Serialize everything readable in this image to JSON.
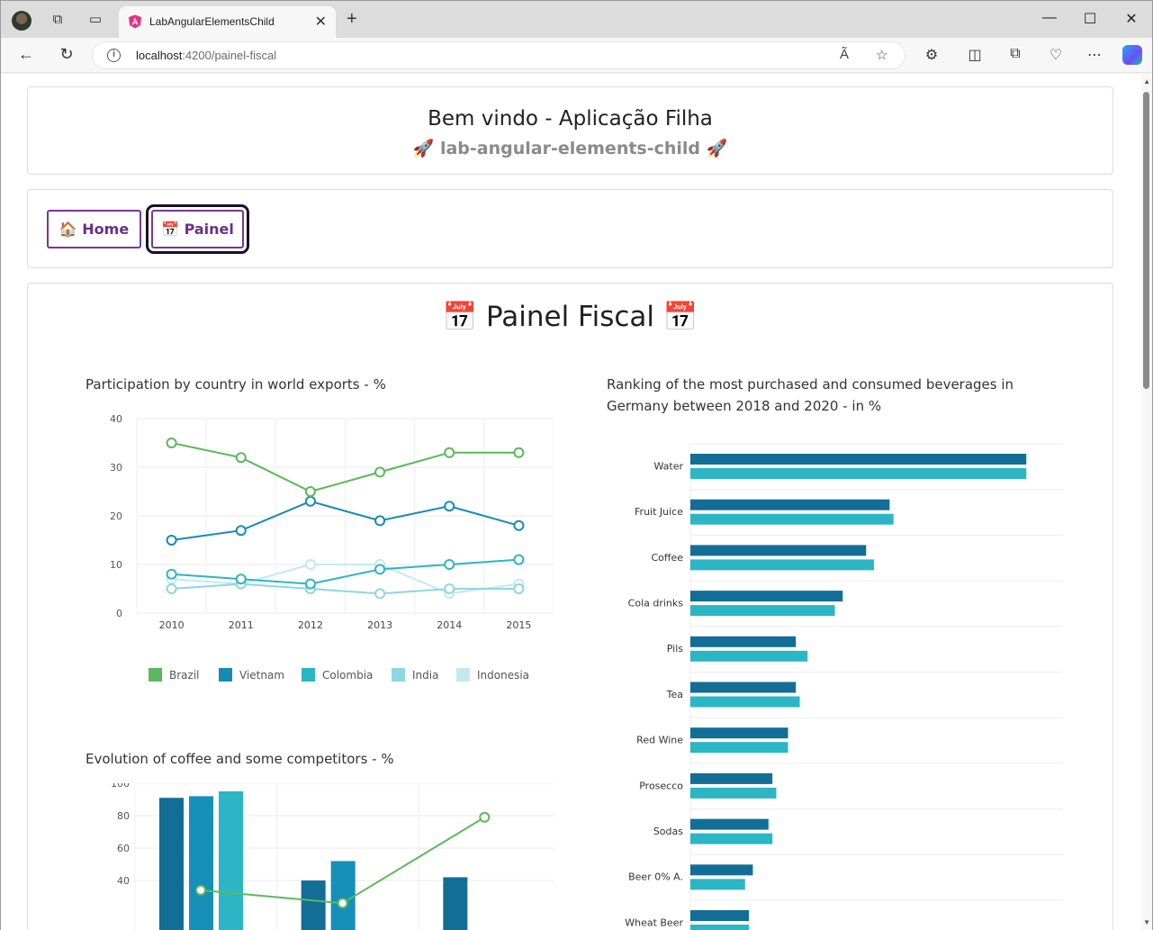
{
  "browser": {
    "tab_title": "LabAngularElementsChild",
    "url_host": "localhost",
    "url_path": ":4200/painel-fiscal",
    "read_aloud_label": "Ã"
  },
  "header": {
    "title": "Bem vindo - Aplicação Filha",
    "subtitle": "🚀 lab-angular-elements-child 🚀"
  },
  "nav": {
    "items": [
      {
        "label": "🏠 Home"
      },
      {
        "label": "📅 Painel"
      }
    ]
  },
  "panel": {
    "title": "📅 Painel Fiscal 📅"
  },
  "colors": {
    "brazil": "#5cb85c",
    "vietnam": "#178cb3",
    "colombia": "#2bb6c4",
    "india": "#8fd6e0",
    "indonesia": "#c3e9ef",
    "bar_dark": "#126e96",
    "bar_mid": "#168fb9",
    "bar_light": "#2cb5c5"
  },
  "chart_data": [
    {
      "type": "line",
      "title": "Participation by country in world exports - %",
      "x": [
        "2010",
        "2011",
        "2012",
        "2013",
        "2014",
        "2015"
      ],
      "ylim": [
        0,
        40
      ],
      "yticks": [
        0,
        10,
        20,
        30,
        40
      ],
      "grid": true,
      "legend": "bottom",
      "series": [
        {
          "name": "Brazil",
          "values": [
            35,
            32,
            25,
            29,
            33,
            33
          ]
        },
        {
          "name": "Vietnam",
          "values": [
            15,
            17,
            23,
            19,
            22,
            18
          ]
        },
        {
          "name": "Colombia",
          "values": [
            8,
            7,
            6,
            9,
            10,
            11
          ]
        },
        {
          "name": "India",
          "values": [
            5,
            6,
            5,
            4,
            5,
            5
          ]
        },
        {
          "name": "Indonesia",
          "values": [
            7,
            6,
            10,
            10,
            4,
            6
          ]
        }
      ]
    },
    {
      "type": "bar",
      "orientation": "horizontal",
      "title": "Ranking of the most purchased and consumed beverages in Germany between 2018 and 2020 - in %",
      "categories": [
        "Water",
        "Fruit Juice",
        "Coffee",
        "Cola drinks",
        "Pils",
        "Tea",
        "Red Wine",
        "Prosecco",
        "Sodas",
        "Beer 0% A.",
        "Wheat Beer"
      ],
      "xlim": [
        0,
        100
      ],
      "grid": true,
      "series": [
        {
          "values": [
            86,
            51,
            45,
            39,
            27,
            27,
            25,
            21,
            20,
            16,
            15
          ]
        },
        {
          "values": [
            86,
            52,
            47,
            37,
            30,
            28,
            25,
            22,
            21,
            14,
            15
          ]
        }
      ]
    },
    {
      "type": "bar",
      "title": "Evolution of coffee and some competitors - %",
      "ylim": [
        0,
        100
      ],
      "yticks": [
        40,
        60,
        80,
        100
      ],
      "grid": true,
      "groups": [
        {
          "values": [
            91,
            92,
            95
          ]
        },
        {
          "values": [
            40,
            52
          ]
        },
        {
          "values": [
            42
          ]
        }
      ],
      "line": {
        "values": [
          34,
          26,
          79
        ]
      }
    }
  ]
}
